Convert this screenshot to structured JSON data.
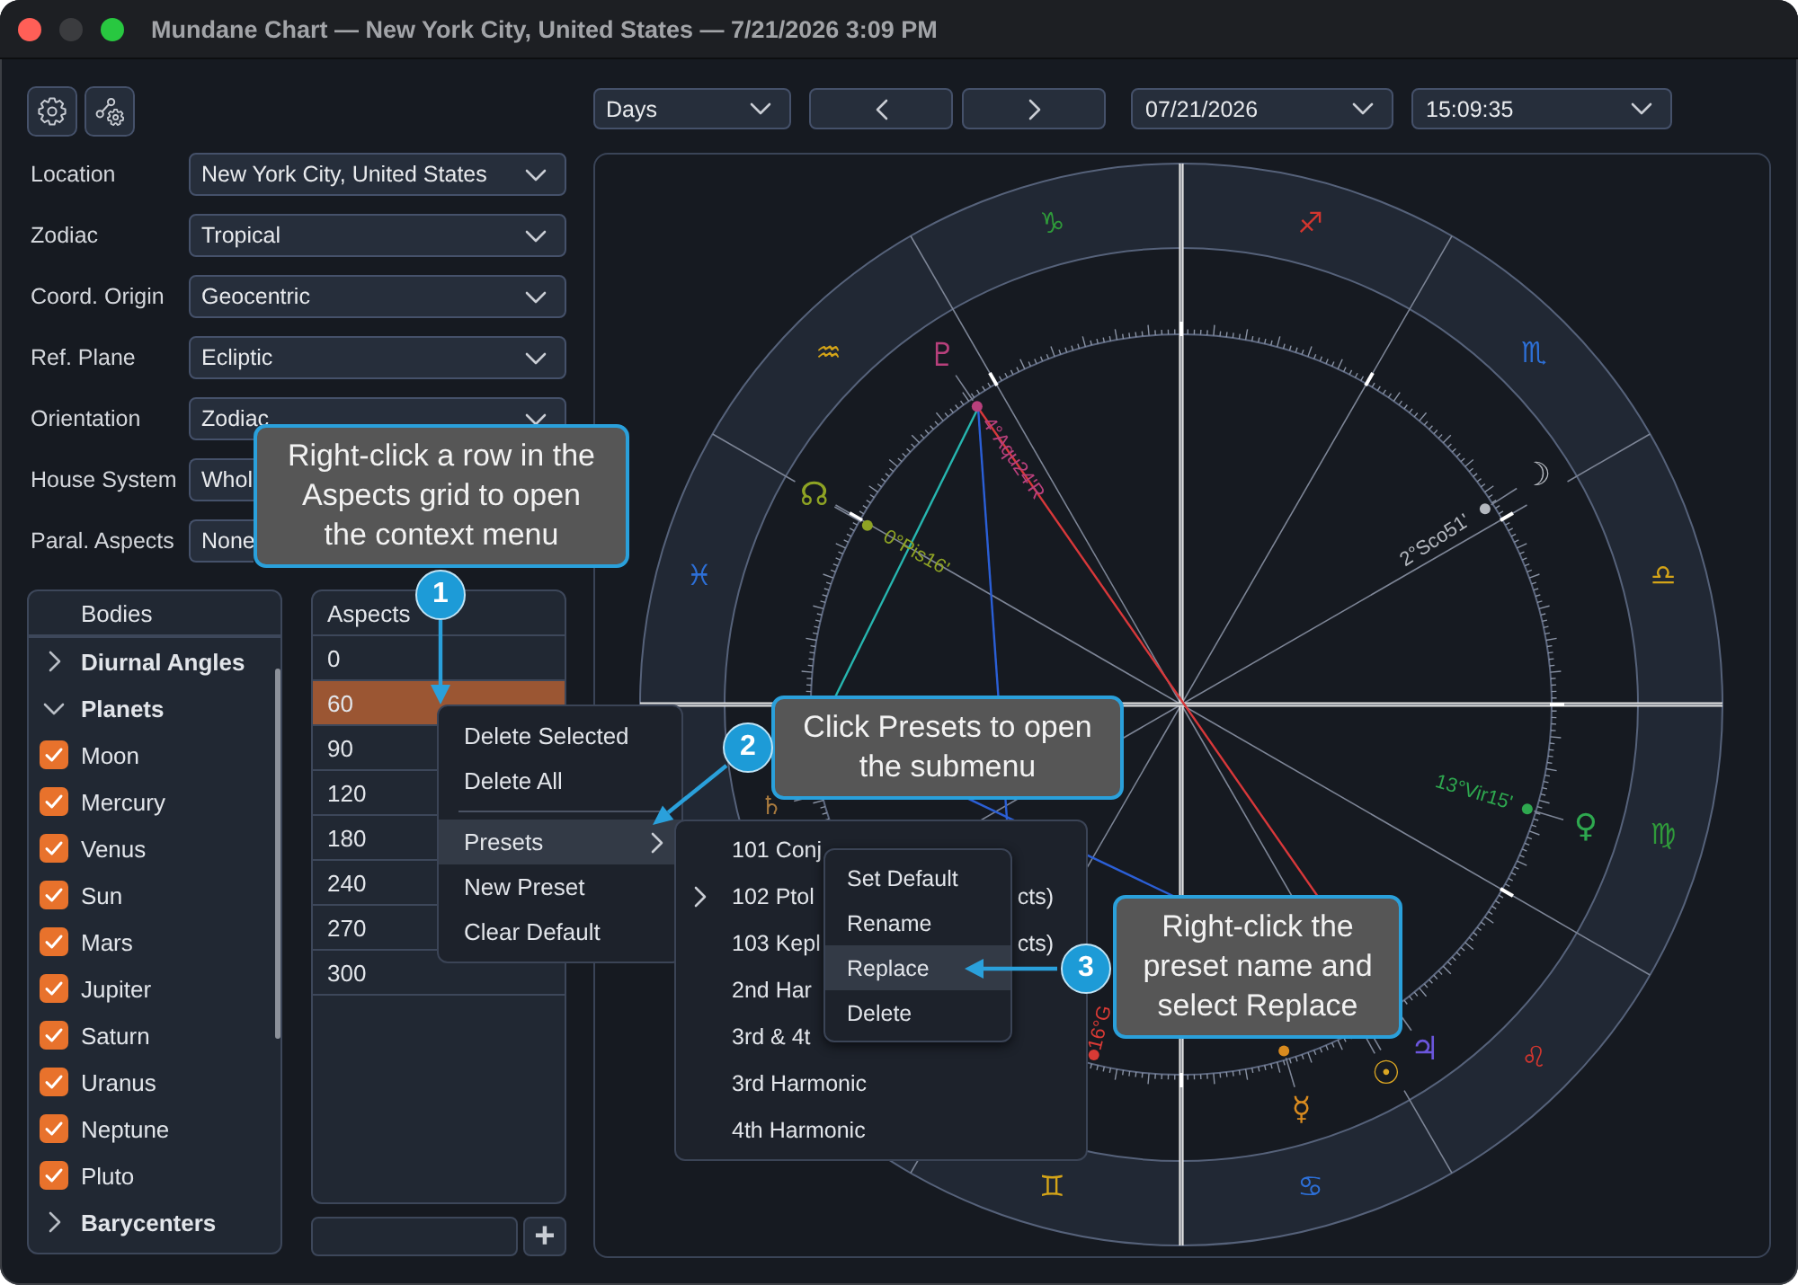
{
  "window": {
    "title": "Mundane Chart — New York City, United States — 7/21/2026 3:09 PM"
  },
  "settings": [
    {
      "label": "Location",
      "value": "New York City, United States"
    },
    {
      "label": "Zodiac",
      "value": "Tropical"
    },
    {
      "label": "Coord. Origin",
      "value": "Geocentric"
    },
    {
      "label": "Ref. Plane",
      "value": "Ecliptic"
    },
    {
      "label": "Orientation",
      "value": "Zodiac"
    },
    {
      "label": "House System",
      "value": "Whol"
    },
    {
      "label": "Paral. Aspects",
      "value": "None"
    }
  ],
  "bodies": {
    "header": "Bodies",
    "groups": [
      {
        "label": "Diurnal Angles",
        "expanded": false
      },
      {
        "label": "Planets",
        "expanded": true,
        "children": [
          {
            "label": "Moon",
            "checked": true
          },
          {
            "label": "Mercury",
            "checked": true
          },
          {
            "label": "Venus",
            "checked": true
          },
          {
            "label": "Sun",
            "checked": true
          },
          {
            "label": "Mars",
            "checked": true
          },
          {
            "label": "Jupiter",
            "checked": true
          },
          {
            "label": "Saturn",
            "checked": true
          },
          {
            "label": "Uranus",
            "checked": true
          },
          {
            "label": "Neptune",
            "checked": true
          },
          {
            "label": "Pluto",
            "checked": true
          }
        ]
      },
      {
        "label": "Barycenters",
        "expanded": false
      }
    ]
  },
  "aspects": {
    "header": "Aspects",
    "rows": [
      {
        "value": "0",
        "selected": false
      },
      {
        "value": "60",
        "selected": true
      },
      {
        "value": "90",
        "selected": false
      },
      {
        "value": "120",
        "selected": false
      },
      {
        "value": "180",
        "selected": false
      },
      {
        "value": "240",
        "selected": false
      },
      {
        "value": "270",
        "selected": false
      },
      {
        "value": "300",
        "selected": false
      }
    ],
    "add_button": "+"
  },
  "time_controls": {
    "step_unit": "Days",
    "date": "07/21/2026",
    "time": "15:09:35"
  },
  "wheel": {
    "zodiac_signs": [
      {
        "glyph": "♑",
        "color": "#2f9a3a"
      },
      {
        "glyph": "♐",
        "color": "#d2362f"
      },
      {
        "glyph": "♏",
        "color": "#2d6fd6"
      },
      {
        "glyph": "♎",
        "color": "#d4a418"
      },
      {
        "glyph": "♍",
        "color": "#2f9a3a"
      },
      {
        "glyph": "♌",
        "color": "#d2362f"
      },
      {
        "glyph": "♋",
        "color": "#2d6fd6"
      },
      {
        "glyph": "♊",
        "color": "#d4a418"
      },
      {
        "glyph": "♓",
        "color": "#2d6fd6"
      },
      {
        "glyph": "♒",
        "color": "#d4a418"
      }
    ],
    "bodies": [
      {
        "glyph": "♇",
        "label": "4°Aqu24'R",
        "color": "#b8407c"
      },
      {
        "glyph": "☊",
        "label": "0°Pis16'",
        "color": "#8ea324"
      },
      {
        "glyph": "☽",
        "label": "2°Sco51'",
        "color": "#b4b8bf"
      },
      {
        "glyph": "♀",
        "label": "13°Vir15'",
        "color": "#2ea84f"
      },
      {
        "glyph": "♃",
        "color": "#6b56dc"
      },
      {
        "glyph": "☉",
        "color": "#dba623"
      },
      {
        "glyph": "☿",
        "color": "#d98b1f"
      },
      {
        "glyph": "♄",
        "color": "#a87a3e"
      },
      {
        "label": "16°G",
        "color": "#d93a35"
      }
    ]
  },
  "context_menu": {
    "sections": [
      {
        "items": [
          {
            "label": "Delete Selected",
            "kind": "item",
            "highlighted": false
          },
          {
            "label": "Delete All",
            "kind": "item",
            "highlighted": false
          }
        ]
      },
      {
        "items": [
          {
            "label": "Presets",
            "kind": "submenu",
            "highlighted": true
          },
          {
            "label": "New Preset",
            "kind": "item",
            "highlighted": false
          },
          {
            "label": "Clear Default",
            "kind": "item",
            "highlighted": false
          }
        ]
      }
    ]
  },
  "presets_menu": {
    "items": [
      {
        "label": "101 Conj",
        "current": false
      },
      {
        "label": "102 Ptol",
        "label_end": "cts)",
        "current": true
      },
      {
        "label": "103 Kepl",
        "label_end": "cts)",
        "current": false
      },
      {
        "label": "2nd Har",
        "current": false
      },
      {
        "label": "3rd & 4t",
        "current": false
      },
      {
        "label": "3rd Harmonic",
        "current": false
      },
      {
        "label": "4th Harmonic",
        "current": false
      }
    ]
  },
  "preset_actions_menu": {
    "items": [
      {
        "label": "Set Default",
        "highlighted": false
      },
      {
        "label": "Rename",
        "highlighted": false
      },
      {
        "label": "Replace",
        "highlighted": true
      },
      {
        "label": "Delete",
        "highlighted": false
      }
    ]
  },
  "callouts": [
    {
      "step": "1",
      "text": "Right-click a row in the\nAspects grid to open\nthe context menu"
    },
    {
      "step": "2",
      "text": "Click Presets to open\nthe submenu"
    },
    {
      "step": "3",
      "text": "Right-click the\npreset name and\nselect Replace"
    }
  ]
}
